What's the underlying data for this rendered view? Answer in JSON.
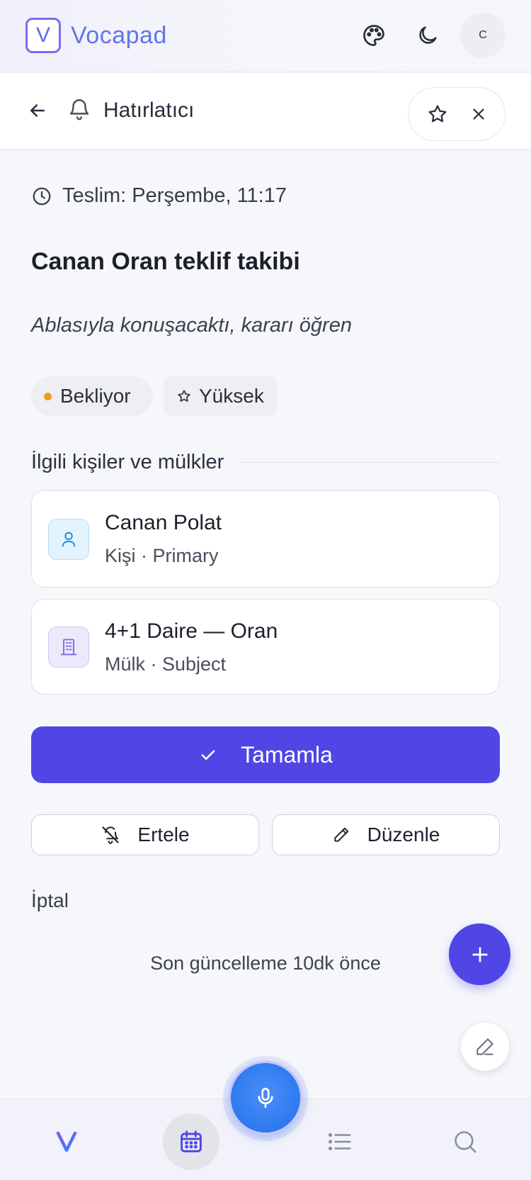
{
  "app": {
    "name": "Vocapad",
    "logo_letter": "V",
    "avatar_initial": "C"
  },
  "header": {
    "title": "Hatırlatıcı"
  },
  "task": {
    "due": "Teslim: Perşembe, 11:17",
    "title": "Canan Oran teklif takibi",
    "description": "Ablasıyla konuşacaktı, kararı öğren",
    "status": "Bekliyor",
    "priority": "Yüksek"
  },
  "related": {
    "heading": "İlgili kişiler ve mülkler",
    "items": [
      {
        "name": "Canan Polat",
        "meta": "Kişi · Primary",
        "icon": "person-icon"
      },
      {
        "name": "4+1 Daire — Oran",
        "meta": "Mülk · Subject",
        "icon": "building-icon"
      }
    ]
  },
  "actions": {
    "complete": "Tamamla",
    "snooze": "Ertele",
    "edit": "Düzenle",
    "cancel": "İptal"
  },
  "footer": {
    "updated": "Son güncelleme 10dk önce"
  },
  "colors": {
    "accent": "#4f46e5",
    "status_dot": "#f29a22",
    "mic": "#2f7df1"
  }
}
